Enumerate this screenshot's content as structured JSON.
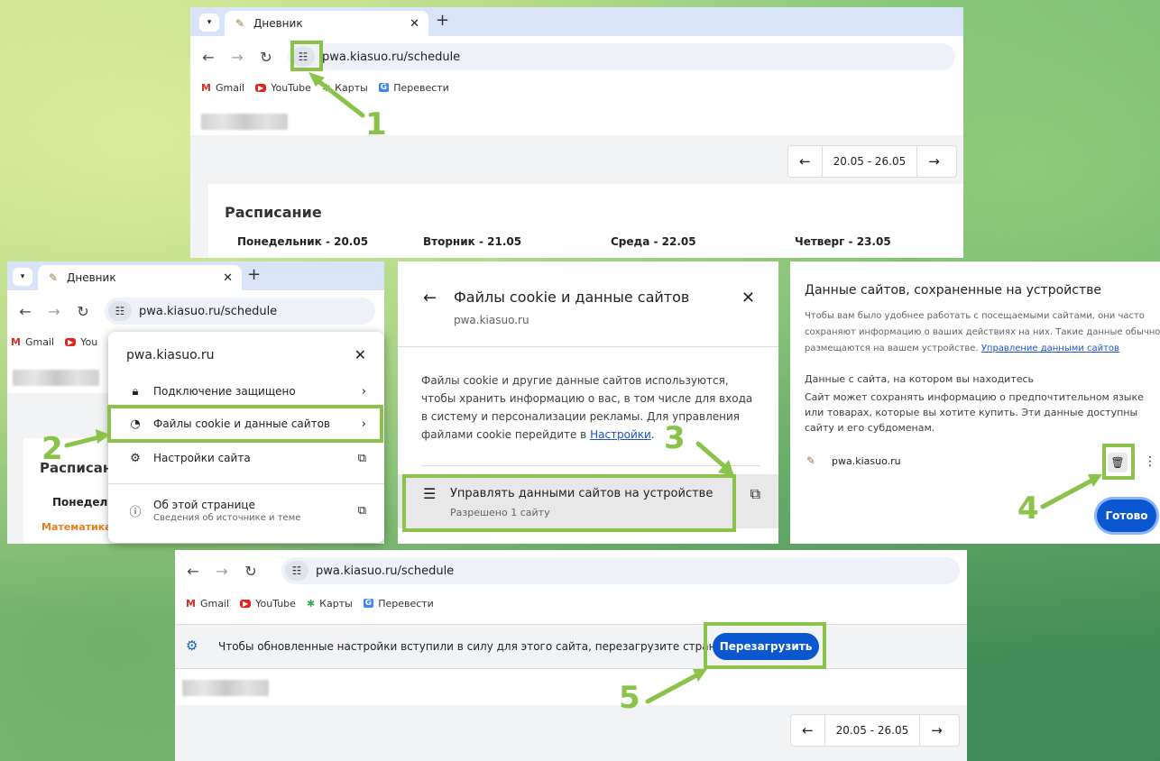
{
  "browser": {
    "tab_title": "Дневник",
    "url": "pwa.kiasuo.ru/schedule",
    "bookmarks": [
      "Gmail",
      "YouTube",
      "Карты",
      "Перевести"
    ],
    "bookmark_truncated": "You",
    "week_range": "20.05 - 26.05"
  },
  "schedule": {
    "title": "Расписание",
    "title_truncated": "Расписан",
    "days": [
      "Понедельник - 20.05",
      "Вторник - 21.05",
      "Среда - 22.05",
      "Четверг - 23.05"
    ],
    "day_truncated": "Понедель",
    "subject_truncated": "Математика"
  },
  "site_popup": {
    "domain": "pwa.kiasuo.ru",
    "items": [
      {
        "label": "Подключение защищено"
      },
      {
        "label": "Файлы cookie и данные сайтов"
      },
      {
        "label": "Настройки сайта"
      },
      {
        "label": "Об этой странице",
        "sublabel": "Сведения об источнике и теме"
      }
    ]
  },
  "cookie_panel": {
    "title": "Файлы cookie и данные сайтов",
    "domain": "pwa.kiasuo.ru",
    "description": "Файлы cookie и другие данные сайтов используются, чтобы хранить информацию о вас, в том числе для входа в систему и персонализации рекламы. Для управления файлами cookie перейдите в",
    "settings_link": "Настройки",
    "period": ".",
    "manage_label": "Управлять данными сайтов на устройстве",
    "manage_sub": "Разрешено 1 сайту"
  },
  "site_data_panel": {
    "title": "Данные сайтов, сохраненные на устройстве",
    "description": "Чтобы вам было удобнее работать с посещаемыми сайтами, они часто сохраняют информацию о ваших действиях на них. Такие данные обычно размещаются на вашем устройстве.",
    "manage_link": "Управление данными сайтов",
    "current_site_heading": "Данные с сайта, на котором вы находитесь",
    "current_site_text": "Сайт может сохранять информацию о предпочтительном языке или товарах, которые вы хотите купить. Эти данные доступны сайту и его субдоменам.",
    "site": "pwa.kiasuo.ru",
    "done_label": "Готово"
  },
  "reload_bar": {
    "message": "Чтобы обновленные настройки вступили в силу для этого сайта, перезагрузите страницу.",
    "button": "Перезагрузить"
  },
  "steps": [
    "1",
    "2",
    "3",
    "4",
    "5"
  ],
  "colors": {
    "highlight": "#8bc34a",
    "primary_button": "#0b57d0",
    "tab_strip": "#d9e4f8"
  }
}
